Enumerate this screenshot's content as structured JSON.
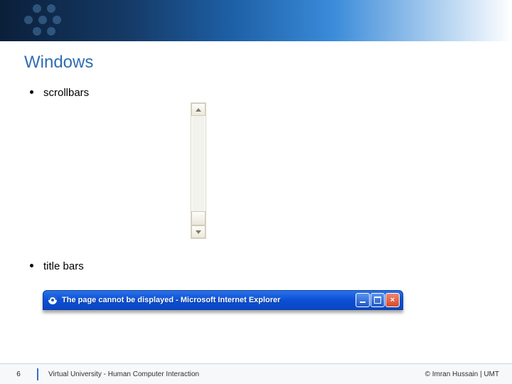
{
  "heading": "Windows",
  "bullets": {
    "scrollbars": "scrollbars",
    "titlebars": "title bars"
  },
  "titlebar": {
    "text": "The page cannot be displayed - Microsoft Internet Explorer"
  },
  "footer": {
    "page_number": "6",
    "center": "Virtual University - Human Computer Interaction",
    "right": "© Imran Hussain | UMT"
  }
}
